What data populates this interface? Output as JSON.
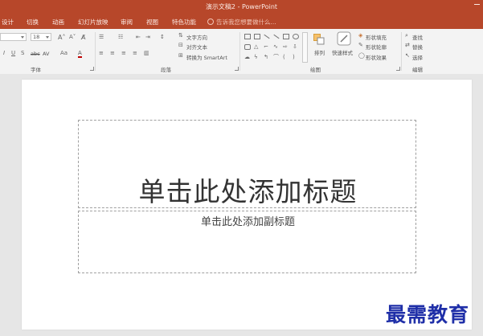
{
  "window": {
    "title": "演示文稿2 - PowerPoint"
  },
  "tabs": [
    {
      "label": "设计"
    },
    {
      "label": "切换"
    },
    {
      "label": "动画"
    },
    {
      "label": "幻灯片放映"
    },
    {
      "label": "审阅"
    },
    {
      "label": "视图"
    },
    {
      "label": "特色功能"
    }
  ],
  "tell_me": {
    "placeholder": "告诉我您想要做什么..."
  },
  "ribbon": {
    "font_group": {
      "label": "字体",
      "font_size": "18",
      "strikethrough": "abc",
      "char_spacing": "AV"
    },
    "paragraph_group": {
      "label": "段落",
      "text_direction": "文字方向",
      "align_text": "对齐文本",
      "smartart": "转换为 SmartArt"
    },
    "drawing_group": {
      "label": "绘图",
      "arrange": "排列",
      "quick_styles": "快速样式",
      "shape_fill": "形状填充",
      "shape_outline": "形状轮廓",
      "shape_effects": "形状效果"
    },
    "editing_group": {
      "label": "编辑",
      "find": "查找",
      "replace": "替换",
      "select": "选择"
    }
  },
  "slide": {
    "title_placeholder": "单击此处添加标题",
    "subtitle_placeholder": "单击此处添加副标题"
  },
  "watermark": "最需教育",
  "colors": {
    "accent": "#b7472a",
    "ribbon_bg": "#f3f3f3",
    "workspace_bg": "#e6e6e6",
    "watermark": "#1f2fa8"
  }
}
